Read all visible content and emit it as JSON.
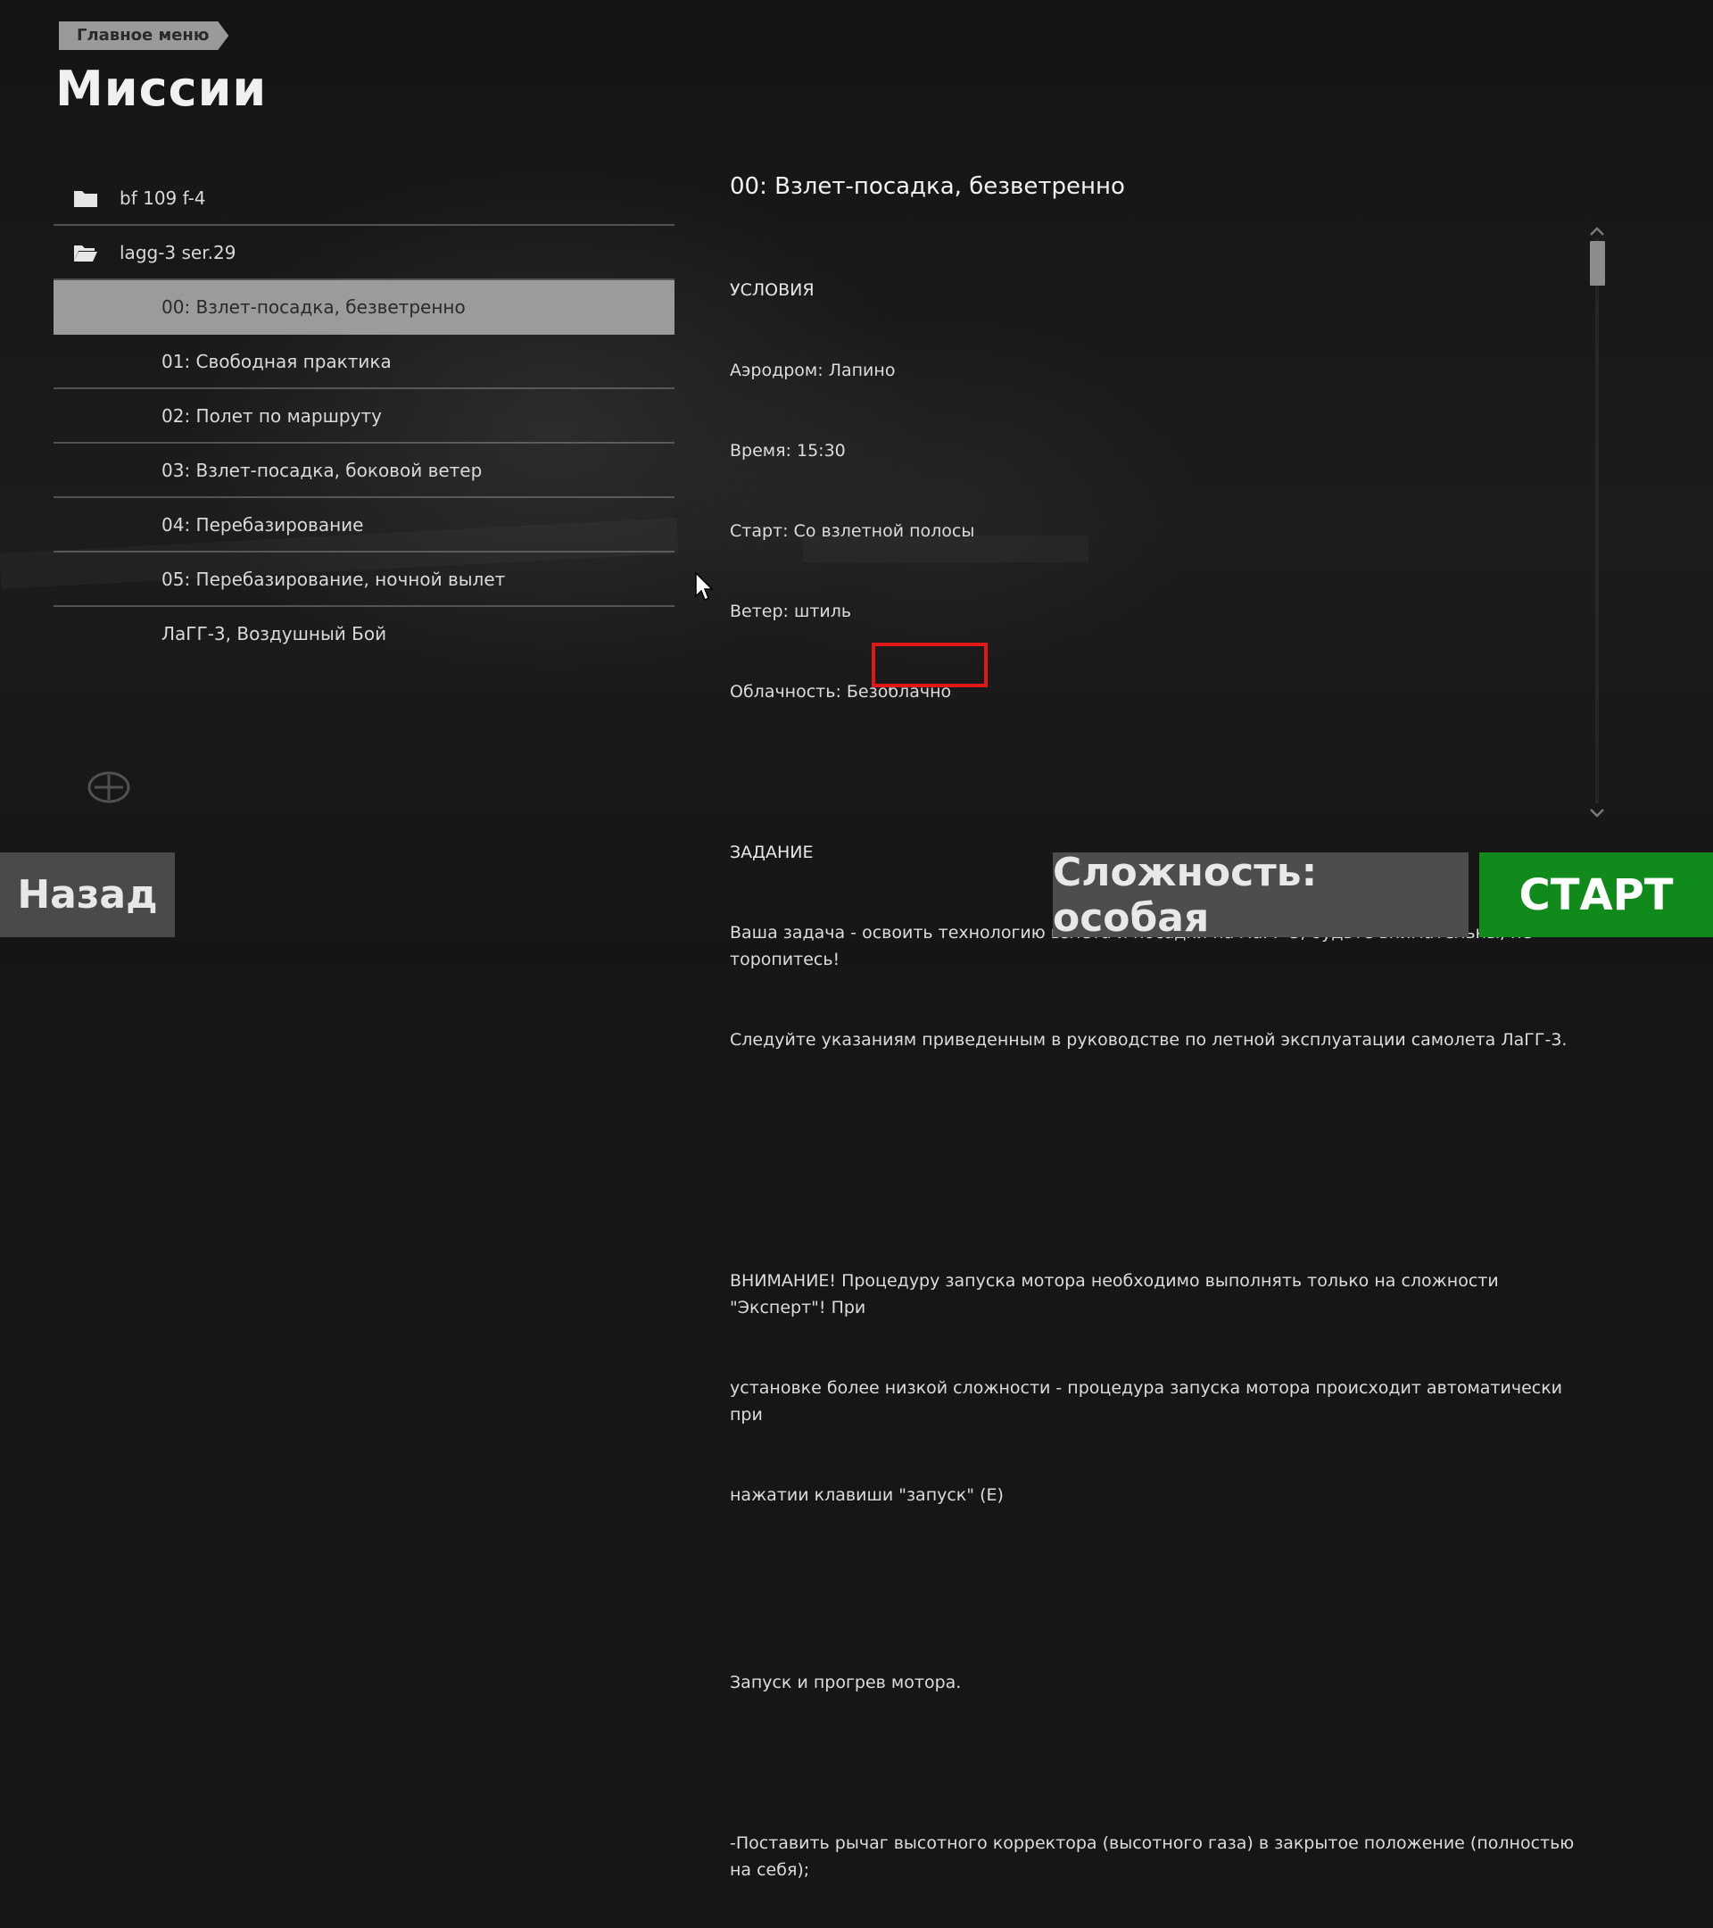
{
  "breadcrumb": {
    "label": "Главное меню"
  },
  "page": {
    "title": "Миссии"
  },
  "mission_list": {
    "folders": [
      {
        "label": "bf 109 f-4",
        "icon": "folder-closed-icon"
      },
      {
        "label": "lagg-3 ser.29",
        "icon": "folder-open-icon"
      }
    ],
    "missions": [
      {
        "label": "00: Взлет-посадка, безветренно",
        "selected": true
      },
      {
        "label": "01: Свободная практика"
      },
      {
        "label": "02: Полет по маршруту"
      },
      {
        "label": "03: Взлет-посадка, боковой ветер"
      },
      {
        "label": "04: Перебазирование"
      },
      {
        "label": "05: Перебазирование, ночной вылет"
      },
      {
        "label": "ЛаГГ-3, Воздушный Бой"
      }
    ]
  },
  "detail": {
    "title": "00: Взлет-посадка, безветренно",
    "conditions_header": "УСЛОВИЯ",
    "conditions": [
      "Аэродром: Лапино",
      "Время: 15:30",
      "Старт: Со взлетной полосы",
      "Ветер: штиль",
      "Облачность: Безоблачно"
    ],
    "task_header": "ЗАДАНИЕ",
    "task_lines": [
      "Ваша задача - освоить технологию взлета и посадки на ЛаГГ-3, будьте внимательны, не торопитесь!",
      "Следуйте указаниям приведенным в руководстве по летной эксплуатации самолета ЛаГГ-3."
    ],
    "warning_lines": [
      "ВНИМАНИЕ! Процедуру запуска мотора необходимо выполнять только на сложности \"Эксперт\"! При",
      "установке более низкой сложности - процедура запуска мотора происходит автоматически при",
      "нажатии клавиши \"запуск\" (E)"
    ],
    "engine_header": "Запуск и прогрев мотора.",
    "engine_step": "-Поставить рычаг высотного корректора (высотного газа) в закрытое положение (полностью на себя);"
  },
  "buttons": {
    "back": "Назад",
    "difficulty": "Сложность: особая",
    "start": "СТАРТ"
  },
  "colors": {
    "start_green": "#0f8a1b",
    "highlight_red": "#e01818",
    "selected_row": "#9b9b9b"
  }
}
